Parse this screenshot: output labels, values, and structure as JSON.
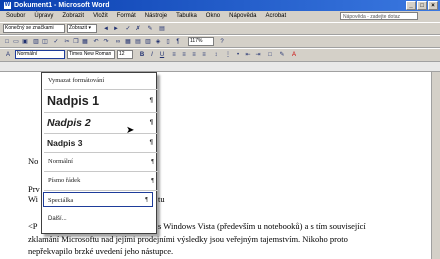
{
  "window": {
    "title": "Dokument1 - Microsoft Word",
    "buttons": [
      "_",
      "□",
      "×"
    ]
  },
  "menubar": {
    "items": [
      "Soubor",
      "Úpravy",
      "Zobrazit",
      "Vložit",
      "Formát",
      "Nástroje",
      "Tabulka",
      "Okno",
      "Nápověda",
      "Acrobat"
    ],
    "help_placeholder": "Nápověda - zadejte dotaz"
  },
  "toolbar1": {
    "style_combo": "Konečný se značkami",
    "show_combo": "Zobrazit ▾"
  },
  "toolbar2": {
    "zoom": "117%"
  },
  "formatting": {
    "style": "Normální",
    "font": "Times New Roman",
    "size": "12"
  },
  "style_dropdown": {
    "items": [
      "Vymazat formátování",
      "Nadpis 1",
      "Nadpis 2",
      "Nadpis 3",
      "Normální",
      "Písmo řádek",
      "Speciálka",
      "Další..."
    ]
  },
  "document": {
    "frag1": "No",
    "frag2": "Prv",
    "frag3": "Wi",
    "frag3b": "tu",
    "frag4": "<P",
    "line1": "s Windows Vista (především u notebooků) a s tím související",
    "line2": "zklamání Microsoftu nad jejími prodejními výsledky jsou veřejným tajemstvím. Nikoho proto",
    "line3": "nepřekvapilo brzké uvedení jeho nástupce."
  }
}
